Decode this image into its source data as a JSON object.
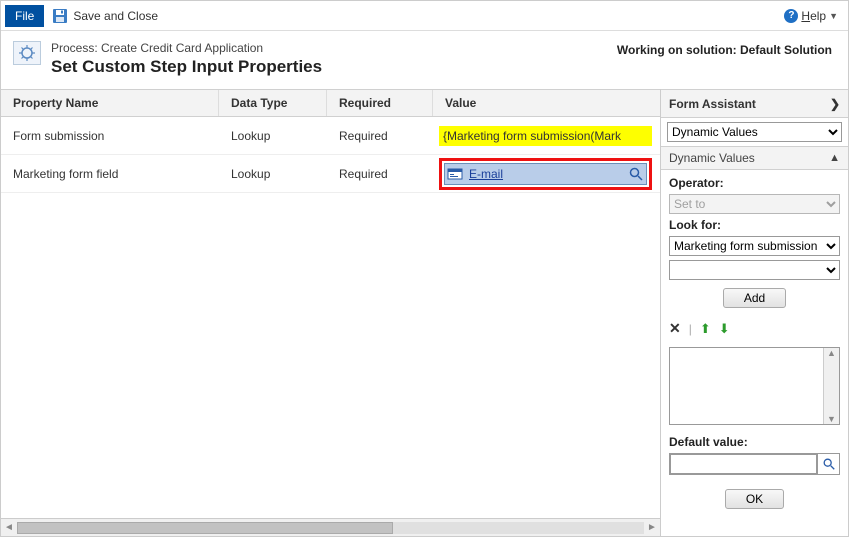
{
  "toolbar": {
    "file_label": "File",
    "save_close_label": "Save and Close",
    "help_label": "Help"
  },
  "header": {
    "process_prefix": "Process: ",
    "process_name": "Create Credit Card Application",
    "title": "Set Custom Step Input Properties",
    "solution_label": "Working on solution: Default Solution"
  },
  "columns": {
    "prop": "Property Name",
    "type": "Data Type",
    "req": "Required",
    "val": "Value"
  },
  "rows": [
    {
      "prop": "Form submission",
      "type": "Lookup",
      "req": "Required",
      "value_text": "{Marketing form submission(Mark",
      "kind": "yellow"
    },
    {
      "prop": "Marketing form field",
      "type": "Lookup",
      "req": "Required",
      "value_text": "E-mail",
      "kind": "lookup"
    }
  ],
  "assistant": {
    "title": "Form Assistant",
    "select_value": "Dynamic Values",
    "sub_title": "Dynamic Values",
    "operator_label": "Operator:",
    "operator_value": "Set to",
    "lookfor_label": "Look for:",
    "lookfor_value": "Marketing form submission",
    "add_label": "Add",
    "default_label": "Default value:",
    "ok_label": "OK"
  }
}
